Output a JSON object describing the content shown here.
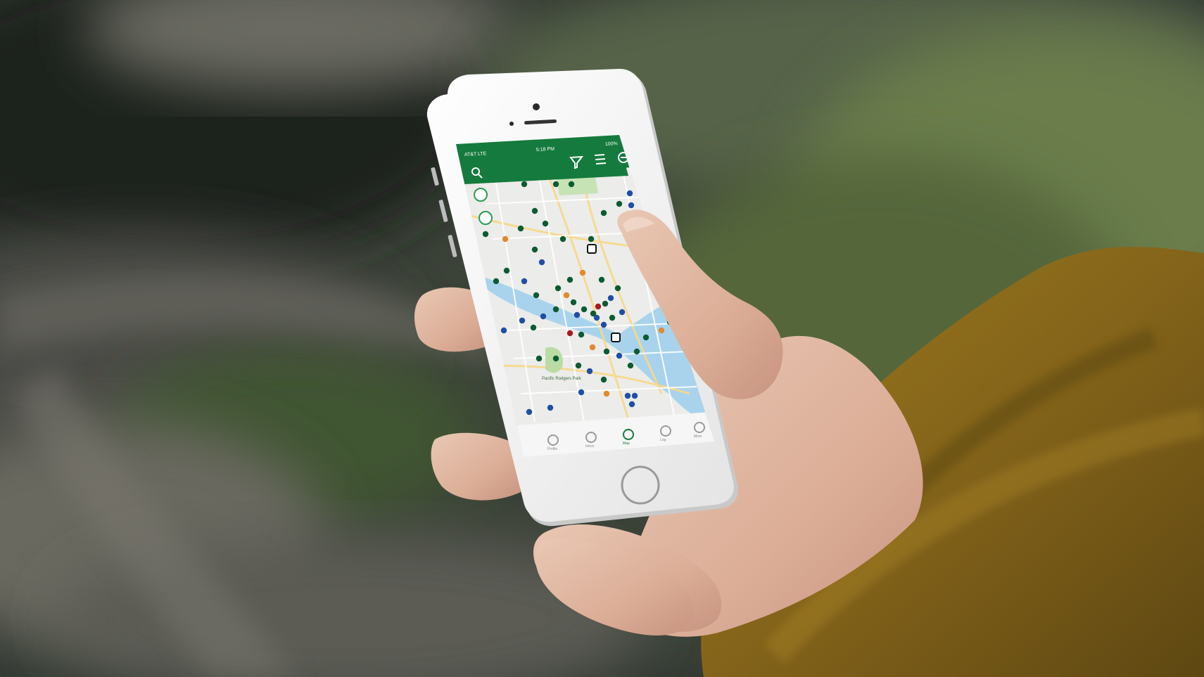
{
  "status_bar": {
    "carrier": "AT&T LTE",
    "time": "5:18 PM",
    "battery": "100%"
  },
  "toolbar": {
    "search_icon": "search-icon",
    "filter_icon": "filter-icon",
    "list_icon": "list-icon",
    "more_icon": "more-icon"
  },
  "map": {
    "park_label": "Pacific Rodgers Park",
    "marker_colors": {
      "green": "#0d5b33",
      "blue": "#1f4fa3",
      "orange": "#e08a2e",
      "red": "#a61e22"
    }
  },
  "tab_bar": {
    "items": [
      {
        "icon": "person-icon",
        "label": "Profile"
      },
      {
        "icon": "mail-icon",
        "label": "Inbox"
      },
      {
        "icon": "map-pin-icon",
        "label": "Map"
      },
      {
        "icon": "book-icon",
        "label": "Log"
      },
      {
        "icon": "grid-icon",
        "label": "More"
      }
    ]
  },
  "colors": {
    "app_green": "#157a3d",
    "water": "#a9d3ec",
    "map_land": "#ececea"
  }
}
